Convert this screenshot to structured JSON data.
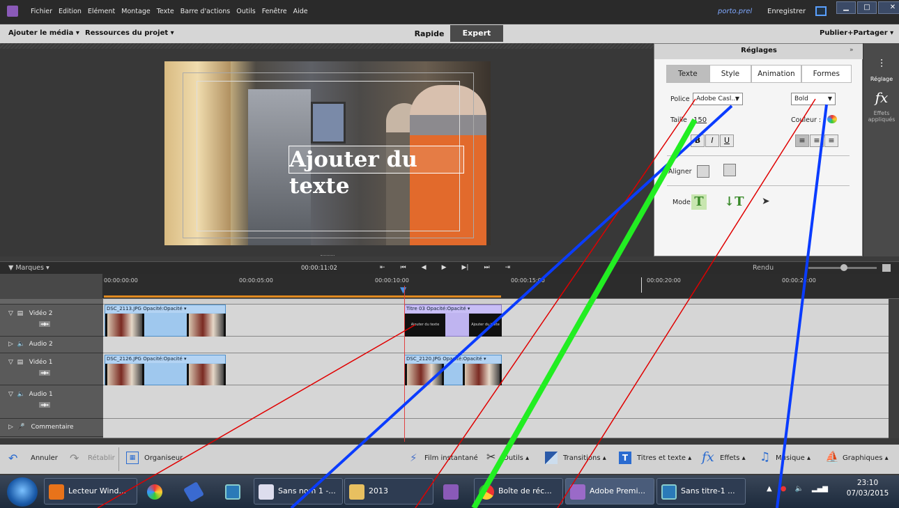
{
  "menubar": {
    "items": [
      "Fichier",
      "Edition",
      "Elément",
      "Montage",
      "Texte",
      "Barre d'actions",
      "Outils",
      "Fenêtre",
      "Aide"
    ],
    "project_name": "porto.prel",
    "save_label": "Enregistrer"
  },
  "toolbar": {
    "add_media": "Ajouter le média",
    "project_resources": "Ressources du projet",
    "quick": "Rapide",
    "expert": "Expert",
    "publish": "Publier+Partager"
  },
  "monitor": {
    "overlay_text": "Ajouter du texte"
  },
  "settings": {
    "header": "Réglages",
    "tabs": [
      "Texte",
      "Style",
      "Animation",
      "Formes"
    ],
    "active_tab": "Texte",
    "font_label": "Police",
    "font_value": "Adobe Casl...",
    "style_value": "Bold",
    "size_label": "Taille",
    "size_value": "150",
    "color_label": "Couleur :",
    "align_label": "Aligner",
    "mode_label": "Mode",
    "bold": "B",
    "italic": "I",
    "underline": "U"
  },
  "sidebar": {
    "reglage_label": "Réglage",
    "effects_label": "Effets appliqués"
  },
  "timeline": {
    "markers_label": "Marques",
    "timecode": "00:00:11:02",
    "render_label": "Rendu",
    "ruler_ticks": [
      "00:00:00:00",
      "00:00:05:00",
      "00:00:10:00",
      "00:00:15:00",
      "00:00:20:00",
      "00:00:25:00"
    ],
    "tracks": [
      "Vidéo 2",
      "Audio 2",
      "Vidéo 1",
      "Audio 1",
      "Commentaire"
    ],
    "clips": {
      "v2a": "DSC_2113.JPG  Opacité:Opacité ▾",
      "v2b": "Titre 03  Opacité:Opacité ▾",
      "v1a": "DSC_2126.JPG  Opacité:Opacité ▾",
      "v1b": "DSC_2120.JPG  Opacité:Opacité ▾"
    }
  },
  "bottom": {
    "undo": "Annuler",
    "redo": "Rétablir",
    "organizer": "Organiseur",
    "instant_movie": "Film instantané",
    "tools": "Outils",
    "transitions": "Transitions",
    "titles": "Titres et texte",
    "effects": "Effets",
    "music": "Musique",
    "graphics": "Graphiques"
  },
  "taskbar": {
    "items": [
      "Lecteur Wind...",
      "Sans nom 1 -...",
      "2013",
      "Boîte de réc...",
      "Adobe Premi...",
      "Sans titre-1 ..."
    ],
    "time": "23:10",
    "date": "07/03/2015"
  },
  "colors": {
    "annotation_red": "#e00000",
    "annotation_blue": "#0a3cff",
    "annotation_green": "#22ee22"
  }
}
